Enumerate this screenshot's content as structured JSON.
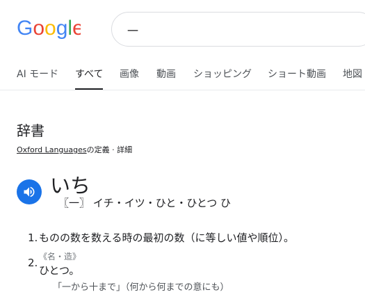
{
  "brand": {
    "logo_text": "Google"
  },
  "search": {
    "query": "一"
  },
  "tabs": [
    {
      "label": "AI モード",
      "active": false
    },
    {
      "label": "すべて",
      "active": true
    },
    {
      "label": "画像",
      "active": false
    },
    {
      "label": "動画",
      "active": false
    },
    {
      "label": "ショッピング",
      "active": false
    },
    {
      "label": "ショート動画",
      "active": false
    },
    {
      "label": "地図",
      "active": false
    }
  ],
  "dictionary": {
    "title": "辞書",
    "source_name": "Oxford Languages",
    "source_suffix": "の定義 · ",
    "details_label": "詳細",
    "headword": "いち",
    "reading": "〖一〗 イチ・イツ・ひと・ひとつ ひ",
    "definitions": [
      {
        "number": "1.",
        "text": "ものの数を数える時の最初の数（に等しい値や順位）。"
      },
      {
        "number": "2.",
        "pos": "《名・造》",
        "text": "ひとつ。",
        "example": "「一から十まで」（何から何までの意にも）"
      }
    ]
  },
  "colors": {
    "accent": "#1a73e8",
    "google_blue": "#4285F4",
    "google_red": "#EA4335",
    "google_yellow": "#FBBC05",
    "google_green": "#34A853"
  }
}
